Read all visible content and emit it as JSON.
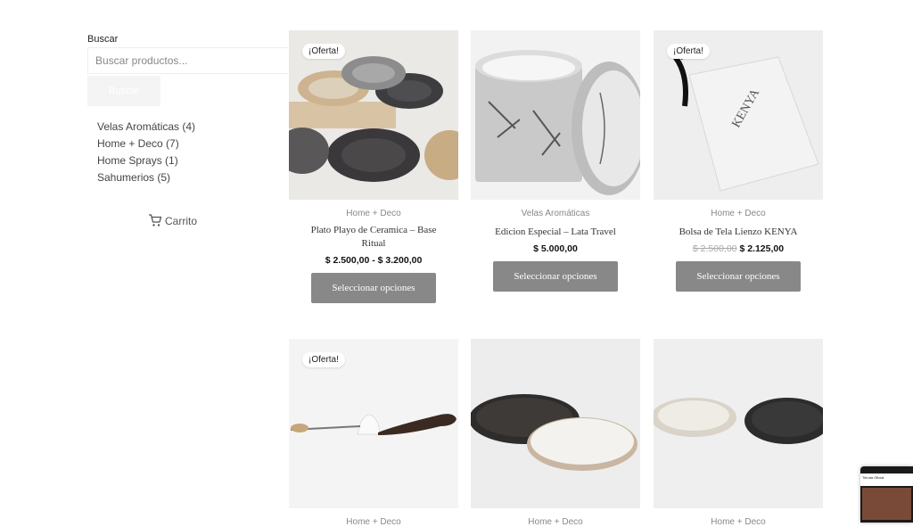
{
  "sidebar": {
    "search_label": "Buscar",
    "search_placeholder": "Buscar productos...",
    "search_button": "Buscar",
    "categories": [
      {
        "name": "Velas Aromáticas",
        "count": "(4)"
      },
      {
        "name": "Home + Deco",
        "count": "(7)"
      },
      {
        "name": "Home Sprays",
        "count": "(1)"
      },
      {
        "name": "Sahumerios",
        "count": "(5)"
      }
    ],
    "cart_label": "Carrito"
  },
  "products": [
    {
      "badge": "¡Oferta!",
      "category": "Home + Deco",
      "title": "Plato Playo de Ceramica – Base Ritual",
      "price": "$ 2.500,00 - $ 3.200,00",
      "button": "Seleccionar opciones"
    },
    {
      "badge": "",
      "category": "Velas Aromáticas",
      "title": "Edicion Especial – Lata Travel",
      "price": "$ 5.000,00",
      "button": "Seleccionar opciones"
    },
    {
      "badge": "¡Oferta!",
      "category": "Home + Deco",
      "title": "Bolsa de Tela Lienzo KENYA",
      "old_price": "$ 2.500,00",
      "price": "$ 2.125,00",
      "button": "Seleccionar opciones"
    },
    {
      "badge": "¡Oferta!",
      "category": "Home + Deco"
    },
    {
      "badge": "",
      "category": "Home + Deco"
    },
    {
      "badge": "",
      "category": "Home + Deco"
    }
  ],
  "preview": {
    "label": "Tienda Oficial"
  },
  "icons": [
    "cart-icon"
  ]
}
